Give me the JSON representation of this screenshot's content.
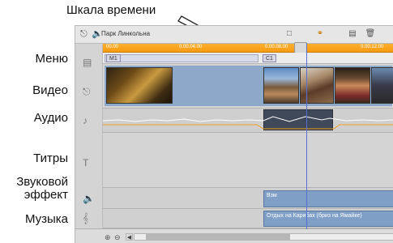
{
  "callout": "Шкала времени",
  "labels": {
    "menu": "Меню",
    "video": "Видео",
    "audio": "Аудио",
    "titles": "Титры",
    "sfx_line1": "Звуковой",
    "sfx_line2": "эффект",
    "music": "Музыка"
  },
  "toolbar": {
    "title": "Парк Линкольна",
    "left_icons": [
      "camera-icon",
      "speaker-icon"
    ],
    "right_icons": [
      "marker-icon",
      "mic-icon",
      "film-icon",
      "trash-icon"
    ]
  },
  "ruler": {
    "ticks": [
      "00.00",
      "0.00.04.00",
      "0.00.08.00",
      "0.00.12.00"
    ]
  },
  "tracks": {
    "menu_markers": [
      "M1",
      "C1"
    ],
    "sfx_clip": "Взм",
    "music_clip": "Отдых на Карибах (бриз на Ямайке)"
  },
  "colors": {
    "ruler": "#f59a10",
    "clip": "#7f9fc6",
    "playhead": "#5a6fd4"
  }
}
